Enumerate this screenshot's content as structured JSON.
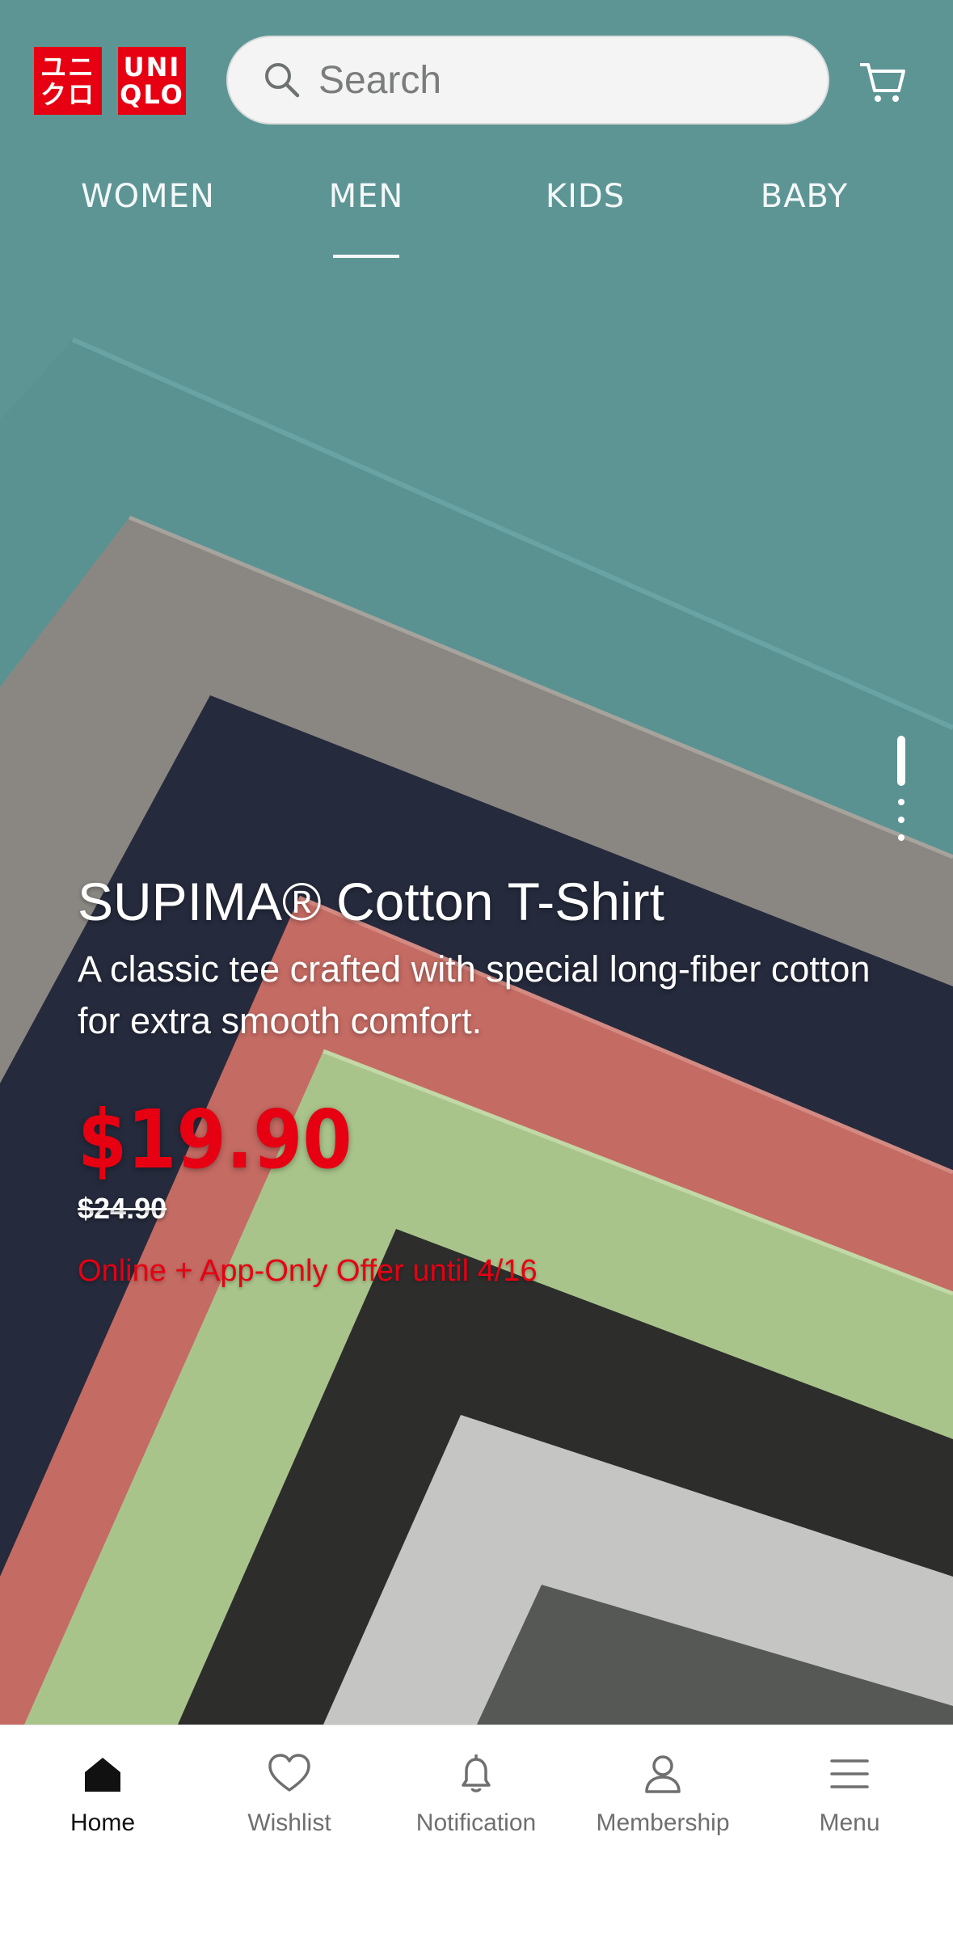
{
  "header": {
    "logo": {
      "line1": "UNI",
      "line2": "QLO",
      "katakana_line1": "ユニ",
      "katakana_line2": "クロ"
    },
    "search": {
      "placeholder": "Search"
    },
    "cart_icon": "cart-icon"
  },
  "nav": {
    "tabs": [
      {
        "label": "WOMEN"
      },
      {
        "label": "MEN"
      },
      {
        "label": "KIDS"
      },
      {
        "label": "BABY"
      }
    ],
    "selected": "MEN"
  },
  "promo": {
    "title": "SUPIMA® Cotton T-Shirt",
    "description": "A classic tee crafted with special long-fiber cotton for extra smooth comfort.",
    "price": "$19.90",
    "original_price": "$24.90",
    "offer": "Online + App-Only Offer until 4/16",
    "carousel": {
      "count": 4,
      "active_index": 0
    }
  },
  "tabbar": {
    "items": [
      {
        "label": "Home",
        "icon": "home-icon"
      },
      {
        "label": "Wishlist",
        "icon": "heart-icon"
      },
      {
        "label": "Notification",
        "icon": "bell-icon"
      },
      {
        "label": "Membership",
        "icon": "person-icon"
      },
      {
        "label": "Menu",
        "icon": "menu-icon"
      }
    ],
    "active": "Home"
  },
  "colors": {
    "brand_red": "#e60012",
    "hero_teal": "#5d9595"
  }
}
